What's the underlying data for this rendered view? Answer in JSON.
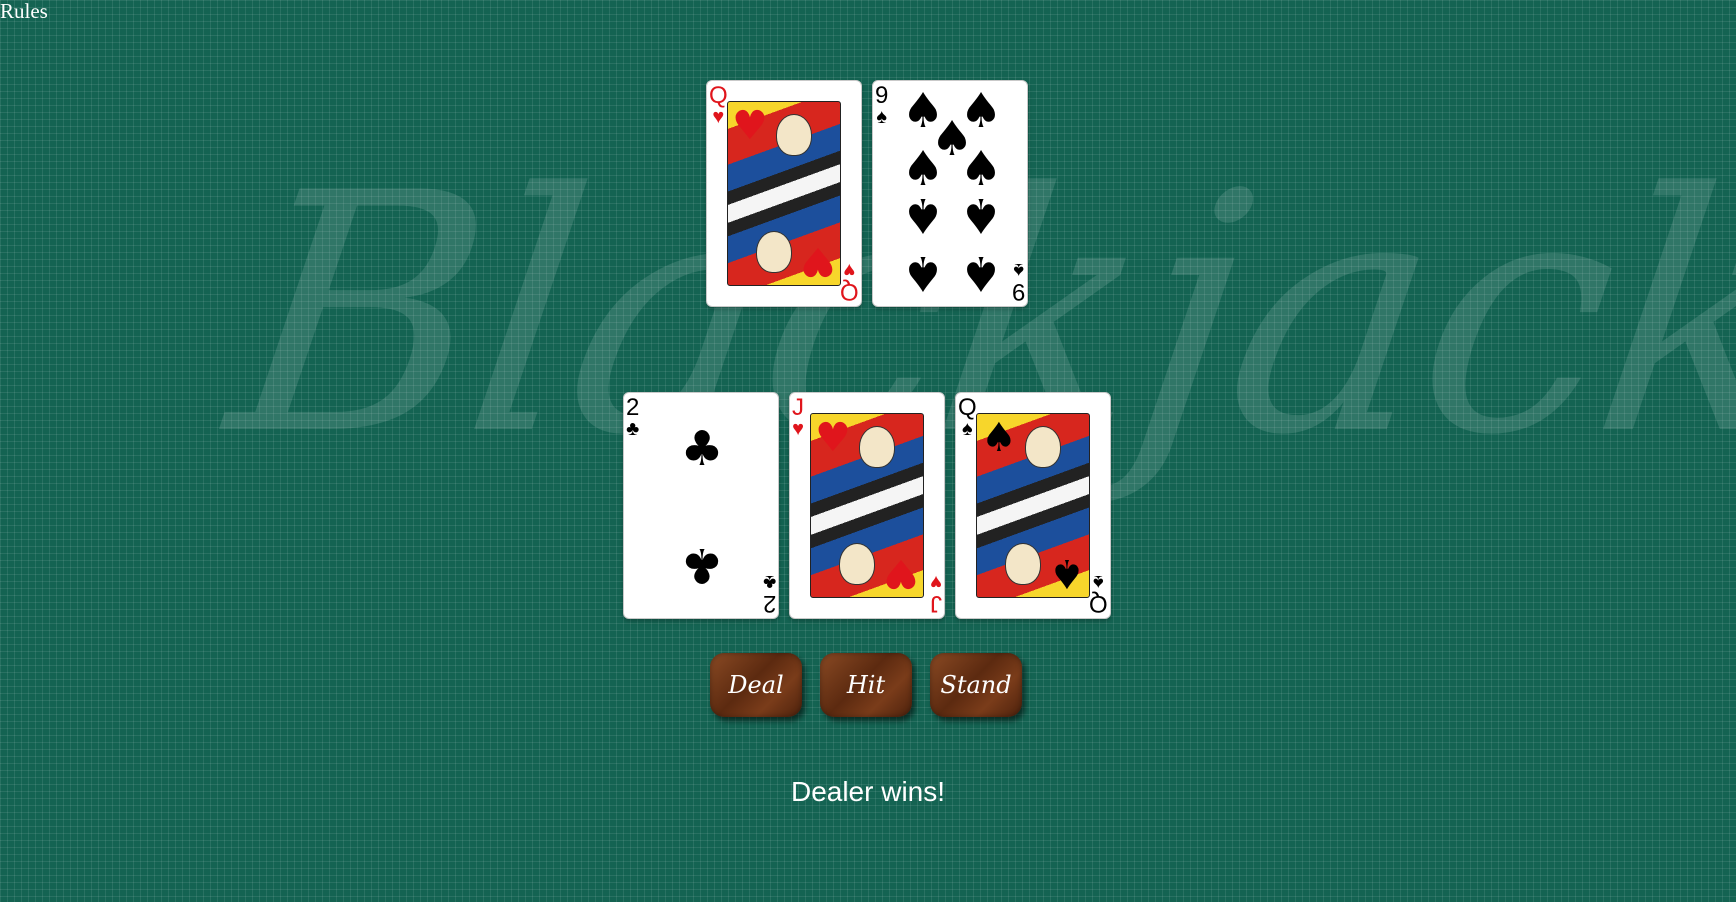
{
  "nav": {
    "rules_label": "Rules"
  },
  "background": {
    "watermark_text": "Blackjack",
    "table_color": "#146352"
  },
  "dealer_hand": [
    {
      "rank": "Q",
      "suit": "♥",
      "color": "red",
      "type": "face"
    },
    {
      "rank": "9",
      "suit": "♠",
      "color": "black",
      "type": "pips"
    }
  ],
  "player_hand": [
    {
      "rank": "2",
      "suit": "♣",
      "color": "black",
      "type": "pips"
    },
    {
      "rank": "J",
      "suit": "♥",
      "color": "red",
      "type": "face"
    },
    {
      "rank": "Q",
      "suit": "♠",
      "color": "black",
      "type": "face"
    }
  ],
  "controls": {
    "deal_label": "Deal",
    "hit_label": "Hit",
    "stand_label": "Stand"
  },
  "status": {
    "message": "Dealer wins!"
  }
}
